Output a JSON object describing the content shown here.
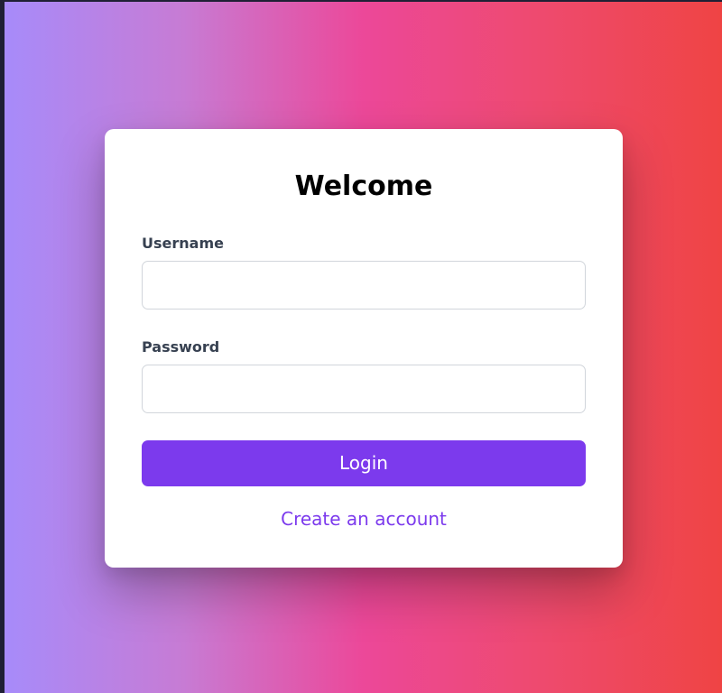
{
  "login_card": {
    "title": "Welcome",
    "username": {
      "label": "Username",
      "value": "",
      "placeholder": ""
    },
    "password": {
      "label": "Password",
      "value": "",
      "placeholder": ""
    },
    "login_button_label": "Login",
    "create_account_link": "Create an account"
  },
  "colors": {
    "gradient_start": "#a78bfa",
    "gradient_middle": "#ec4899",
    "gradient_end": "#ef4444",
    "accent": "#7c3aed",
    "label_text": "#374151",
    "input_border": "#d1d5db",
    "window_frame": "#1f2035"
  }
}
